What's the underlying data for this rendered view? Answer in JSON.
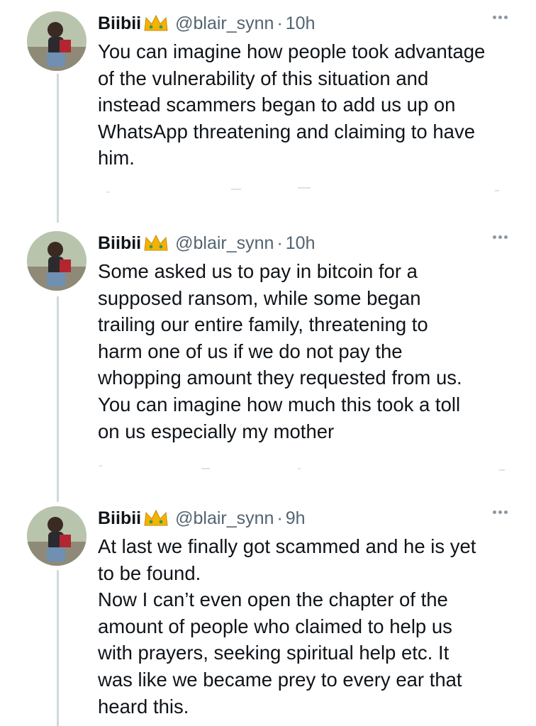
{
  "tweets": [
    {
      "name": "Biibii",
      "badge": "crown-emoji",
      "handle": "@blair_synn",
      "separator": "·",
      "time": "10h",
      "text": "You can imagine how people took advantage\nof the vulnerability of this situation and\ninstead scammers began to add us up on\nWhatsApp threatening and claiming to have\nhim."
    },
    {
      "name": "Biibii",
      "badge": "crown-emoji",
      "handle": "@blair_synn",
      "separator": "·",
      "time": "10h",
      "text": "Some asked us to pay in bitcoin for a\nsupposed ransom, while some began\ntrailing our entire family, threatening to\nharm one of us if we do not pay the\nwhopping amount they requested from us.\nYou can imagine how much this took a toll\non us especially my mother"
    },
    {
      "name": "Biibii",
      "badge": "crown-emoji",
      "handle": "@blair_synn",
      "separator": "·",
      "time": "9h",
      "text": "At last we finally got scammed and he is yet\nto be found.\nNow I can’t even open the chapter of the\namount of people who claimed to help us\nwith prayers, seeking spiritual help etc. It\nwas like we became prey to every ear that\nheard this."
    }
  ],
  "colors": {
    "text": "#0f1419",
    "secondary": "#536471",
    "thread_line": "#cfd9de",
    "crown": "#f5b301"
  }
}
